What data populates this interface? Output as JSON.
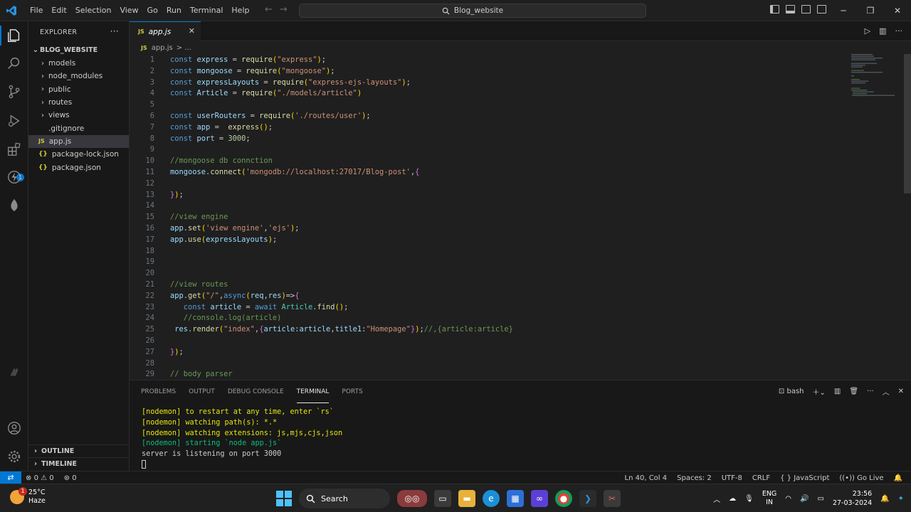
{
  "titlebar": {
    "menu": [
      "File",
      "Edit",
      "Selection",
      "View",
      "Go",
      "Run",
      "Terminal",
      "Help"
    ],
    "search_text": "Blog_website"
  },
  "sidebar": {
    "title": "EXPLORER",
    "project": "BLOG_WEBSITE",
    "items": [
      {
        "label": "models",
        "type": "folder"
      },
      {
        "label": "node_modules",
        "type": "folder"
      },
      {
        "label": "public",
        "type": "folder"
      },
      {
        "label": "routes",
        "type": "folder"
      },
      {
        "label": "views",
        "type": "folder"
      },
      {
        "label": ".gitignore",
        "type": "file"
      },
      {
        "label": "app.js",
        "type": "js"
      },
      {
        "label": "package-lock.json",
        "type": "json"
      },
      {
        "label": "package.json",
        "type": "json"
      }
    ],
    "outline": "OUTLINE",
    "timeline": "TIMELINE",
    "js_icon": "JS",
    "json_icon": "{}"
  },
  "editor": {
    "tab_label": "app.js",
    "breadcrumb_file": "app.js",
    "breadcrumb_sep": "> ...",
    "lines": [
      {
        "n": "1",
        "t": "const express = require(\"express\");"
      },
      {
        "n": "2",
        "t": "const mongoose = require(\"mongoose\");"
      },
      {
        "n": "3",
        "t": "const expressLayouts = require(\"express-ejs-layouts\");"
      },
      {
        "n": "4",
        "t": "const Article = require(\"./models/article\")"
      },
      {
        "n": "5",
        "t": ""
      },
      {
        "n": "6",
        "t": "const userRouters = require('./routes/user');"
      },
      {
        "n": "7",
        "t": "const app =  express();"
      },
      {
        "n": "8",
        "t": "const port = 3000;"
      },
      {
        "n": "9",
        "t": ""
      },
      {
        "n": "10",
        "t": "//mongoose db connction"
      },
      {
        "n": "11",
        "t": "mongoose.connect('mongodb://localhost:27017/Blog-post',{"
      },
      {
        "n": "12",
        "t": ""
      },
      {
        "n": "13",
        "t": "});"
      },
      {
        "n": "14",
        "t": ""
      },
      {
        "n": "15",
        "t": "//view engine"
      },
      {
        "n": "16",
        "t": "app.set('view engine','ejs');"
      },
      {
        "n": "17",
        "t": "app.use(expressLayouts);"
      },
      {
        "n": "18",
        "t": ""
      },
      {
        "n": "19",
        "t": ""
      },
      {
        "n": "20",
        "t": ""
      },
      {
        "n": "21",
        "t": "//view routes"
      },
      {
        "n": "22",
        "t": "app.get(\"/\",async(req,res)=>{"
      },
      {
        "n": "23",
        "t": "   const article = await Article.find();"
      },
      {
        "n": "24",
        "t": "   //console.log(article)"
      },
      {
        "n": "25",
        "t": " res.render(\"index\",{article:article,title1:\"Homepage\"});//,{article:article}"
      },
      {
        "n": "26",
        "t": ""
      },
      {
        "n": "27",
        "t": "});"
      },
      {
        "n": "28",
        "t": ""
      },
      {
        "n": "29",
        "t": "// body parser"
      }
    ]
  },
  "panel": {
    "tabs": [
      "PROBLEMS",
      "OUTPUT",
      "DEBUG CONSOLE",
      "TERMINAL",
      "PORTS"
    ],
    "active_tab": "TERMINAL",
    "shell": "bash",
    "terminal": [
      {
        "prefix": "[nodemon]",
        "text": " to restart at any time, enter `rs`",
        "color": "yellow"
      },
      {
        "prefix": "[nodemon]",
        "text": " watching path(s): *.*",
        "color": "yellow"
      },
      {
        "prefix": "[nodemon]",
        "text": " watching extensions: js,mjs,cjs,json",
        "color": "yellow"
      },
      {
        "prefix": "[nodemon]",
        "text": " starting `node app.js`",
        "color": "green"
      },
      {
        "prefix": "",
        "text": "server is listening on port 3000",
        "color": "plain"
      }
    ]
  },
  "statusbar": {
    "errors": "0",
    "warnings": "0",
    "ports": "0",
    "position": "Ln 40, Col 4",
    "spaces": "Spaces: 2",
    "encoding": "UTF-8",
    "eol": "CRLF",
    "language": "JavaScript",
    "golive": "Go Live"
  },
  "taskbar": {
    "weather_badge": "1",
    "temperature": "25°C",
    "condition": "Haze",
    "search_label": "Search",
    "lang_top": "ENG",
    "lang_bottom": "IN",
    "time": "23:56",
    "date": "27-03-2024"
  },
  "colors": {
    "accent": "#0078d4",
    "background": "#1f1f1f",
    "sidebar": "#181818"
  }
}
